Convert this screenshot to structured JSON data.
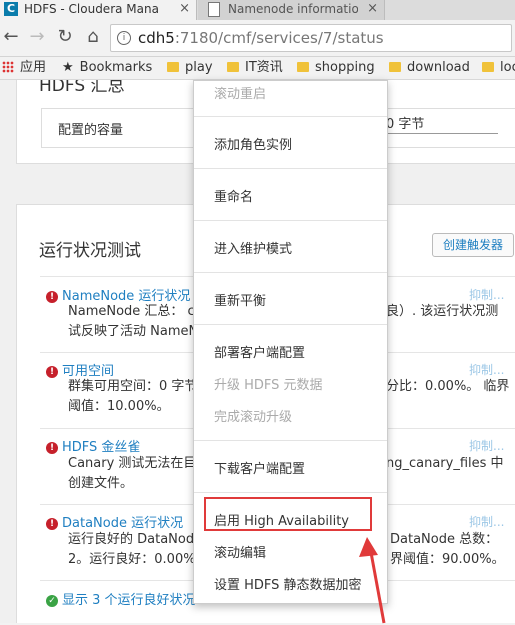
{
  "browser": {
    "tabs": [
      {
        "title": "HDFS - Cloudera Mana",
        "close": "×"
      },
      {
        "title": "Namenode information",
        "close": "×"
      }
    ],
    "url": {
      "host": "cdh5",
      "rest": ":7180/cmf/services/7/status"
    },
    "bookmarks": [
      {
        "label": "应用",
        "icon": "apps-icon"
      },
      {
        "label": "Bookmarks",
        "icon": "star-icon"
      },
      {
        "label": "play",
        "icon": "folder-icon"
      },
      {
        "label": "IT资讯",
        "icon": "folder-icon"
      },
      {
        "label": "shopping",
        "icon": "folder-icon"
      },
      {
        "label": "download",
        "icon": "folder-icon"
      },
      {
        "label": "loc",
        "icon": "folder-icon"
      }
    ]
  },
  "hdfs_summary": {
    "title": "HDFS 汇总",
    "capacity_label": "配置的容量",
    "capacity_value": "0 字节"
  },
  "health_tests": {
    "title": "运行状况测试",
    "create_trigger": "创建触发器",
    "suppress_label": "抑制...",
    "items": [
      {
        "title": "NameNode 运行状况",
        "line1_left": "NameNode 汇总： cd",
        "line1_right": "良）. 该运行状况测",
        "line2_left": "试反映了活动 NameN",
        "line2_right": ""
      },
      {
        "title": "可用空间",
        "line1_left": "群集可用空间：0 字节",
        "line1_right": "分比：0.00%。 临界",
        "line2_left": "阈值：10.00%。",
        "line2_right": ""
      },
      {
        "title": "HDFS 金丝雀",
        "line1_left": "Canary 测试无法在目录",
        "line1_right": "ng_canary_files 中",
        "line2_left": "创建文件。",
        "line2_right": ""
      },
      {
        "title": "DataNode 运行状况",
        "line1_left": "运行良好的 DataNode",
        "line1_right": "DataNode 总数：",
        "line2_left": "2。运行良好：0.00%。",
        "line2_right": "界阈值：90.00%。"
      }
    ],
    "show_good": "显示 3 个运行良好状况"
  },
  "menu": {
    "items": [
      {
        "label": "滚动重启",
        "disabled": true
      },
      {
        "label": "添加角色实例",
        "disabled": false
      },
      {
        "label": "重命名",
        "disabled": false
      },
      {
        "label": "进入维护模式",
        "disabled": false
      },
      {
        "label": "重新平衡",
        "disabled": false
      },
      {
        "label": "部署客户端配置",
        "disabled": false
      },
      {
        "label": "升级 HDFS 元数据",
        "disabled": true
      },
      {
        "label": "完成滚动升级",
        "disabled": true
      },
      {
        "label": "下载客户端配置",
        "disabled": false
      },
      {
        "label": "启用 High Availability",
        "disabled": false
      },
      {
        "label": "滚动编辑",
        "disabled": false
      },
      {
        "label": "设置 HDFS 静态数据加密",
        "disabled": false
      }
    ]
  },
  "colors": {
    "highlight": "#e03a3a",
    "link": "#1f7fc1",
    "error": "#c6202b",
    "ok": "#3aa345"
  }
}
